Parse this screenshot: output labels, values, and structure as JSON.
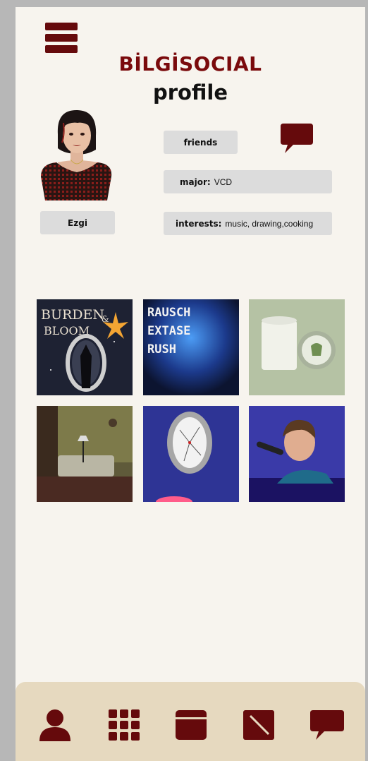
{
  "app": {
    "brand": "BİLGİSOCIAL",
    "page_title": "profile"
  },
  "icons": {
    "menu": "hamburger-menu-icon",
    "message": "chat-bubble-icon",
    "nav": [
      "profile-icon",
      "grid-icon",
      "calendar-icon",
      "edit-icon",
      "chat-icon"
    ]
  },
  "colors": {
    "accent": "#650a0c",
    "background": "#f7f4ee",
    "pill": "#dcdcdc",
    "bottom_bar": "#e6d9bf"
  },
  "profile": {
    "name": "Ezgi",
    "friends_label": "friends",
    "major_label": "major:",
    "major_value": "VCD",
    "interests_label": "interests:",
    "interests_value": "music, drawing,cooking"
  },
  "posts": [
    {
      "caption_line1": "BURDEN",
      "caption_amp": "&",
      "caption_line2": "BLOOM"
    },
    {
      "lines": [
        "RAUSCH",
        "EXTASE",
        "RUSH"
      ]
    },
    {
      "label": "packaging-mockup"
    },
    {
      "label": "room-render"
    },
    {
      "label": "mirror-illustration"
    },
    {
      "label": "singer-illustration"
    }
  ]
}
